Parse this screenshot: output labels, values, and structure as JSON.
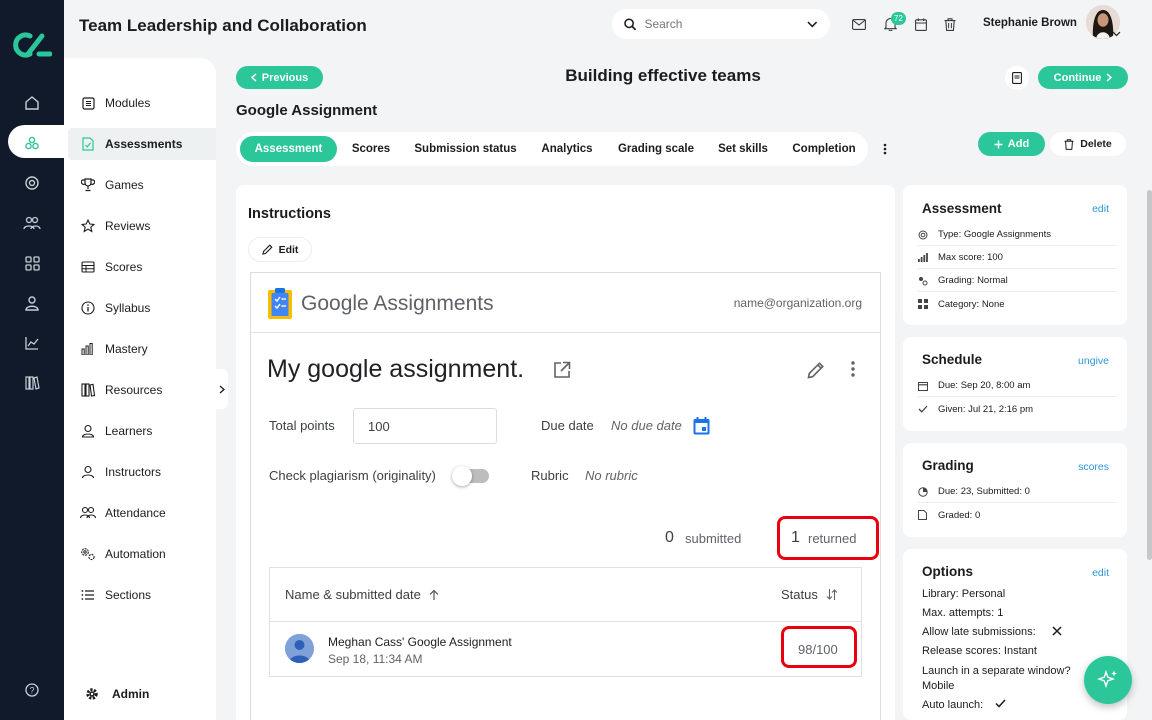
{
  "app": {
    "title": "Team Leadership and Collaboration"
  },
  "header": {
    "search_placeholder": "Search",
    "notification_count": "72",
    "user_name": "Stephanie Brown"
  },
  "nav": {
    "admin_label": "Admin",
    "items": [
      {
        "label": "Modules",
        "icon": "modules-icon"
      },
      {
        "label": "Assessments",
        "icon": "assessments-icon",
        "active": true
      },
      {
        "label": "Games",
        "icon": "trophy-icon"
      },
      {
        "label": "Reviews",
        "icon": "star-icon"
      },
      {
        "label": "Scores",
        "icon": "table-icon"
      },
      {
        "label": "Syllabus",
        "icon": "info-icon"
      },
      {
        "label": "Mastery",
        "icon": "bar-chart-icon"
      },
      {
        "label": "Resources",
        "icon": "library-icon"
      },
      {
        "label": "Learners",
        "icon": "person-icon"
      },
      {
        "label": "Instructors",
        "icon": "person-outline-icon"
      },
      {
        "label": "Attendance",
        "icon": "people-icon"
      },
      {
        "label": "Automation",
        "icon": "gears-icon"
      },
      {
        "label": "Sections",
        "icon": "list-icon"
      }
    ]
  },
  "page": {
    "prev_label": "Previous",
    "continue_label": "Continue",
    "module_title": "Building effective teams",
    "assignment_title": "Google Assignment",
    "add_label": "Add",
    "delete_label": "Delete",
    "tabs": [
      "Assessment",
      "Scores",
      "Submission status",
      "Analytics",
      "Grading scale",
      "Set skills",
      "Completion"
    ]
  },
  "instructions": {
    "heading": "Instructions",
    "edit_label": "Edit"
  },
  "google": {
    "brand_google": "Google",
    "brand_product": "Assignments",
    "email": "name@organization.org",
    "assignment_title": "My google assignment.",
    "total_points_label": "Total points",
    "total_points_value": "100",
    "due_date_label": "Due date",
    "due_date_value": "No due date",
    "plagiarism_label": "Check plagiarism (originality)",
    "rubric_label": "Rubric",
    "rubric_value": "No rubric",
    "submitted_count": "0",
    "submitted_label": "submitted",
    "returned_count": "1",
    "returned_label": "returned",
    "col_name": "Name & submitted date",
    "col_status": "Status",
    "row": {
      "name": "Meghan Cass' Google Assignment",
      "date": "Sep 18, 11:34 AM",
      "score": "98/100"
    }
  },
  "assessment_card": {
    "title": "Assessment",
    "link": "edit",
    "rows": [
      "Type: Google Assignments",
      "Max score: 100",
      "Grading: Normal",
      "Category: None"
    ]
  },
  "schedule_card": {
    "title": "Schedule",
    "link": "ungive",
    "rows": [
      "Due: Sep 20, 8:00 am",
      "Given: Jul 21, 2:16 pm"
    ]
  },
  "grading_card": {
    "title": "Grading",
    "link": "scores",
    "rows": [
      "Due: 23, Submitted: 0",
      "Graded: 0"
    ]
  },
  "options_card": {
    "title": "Options",
    "link": "edit",
    "rows": [
      "Library: Personal",
      "Max. attempts: 1",
      "Allow late submissions:",
      "Release scores: Instant",
      "Launch in a separate window?",
      "Mobile",
      "Auto launch:"
    ]
  },
  "colors": {
    "accent": "#2bc79a",
    "rail": "#101a2b",
    "link": "#2d95d6",
    "highlight": "#e8000f"
  }
}
